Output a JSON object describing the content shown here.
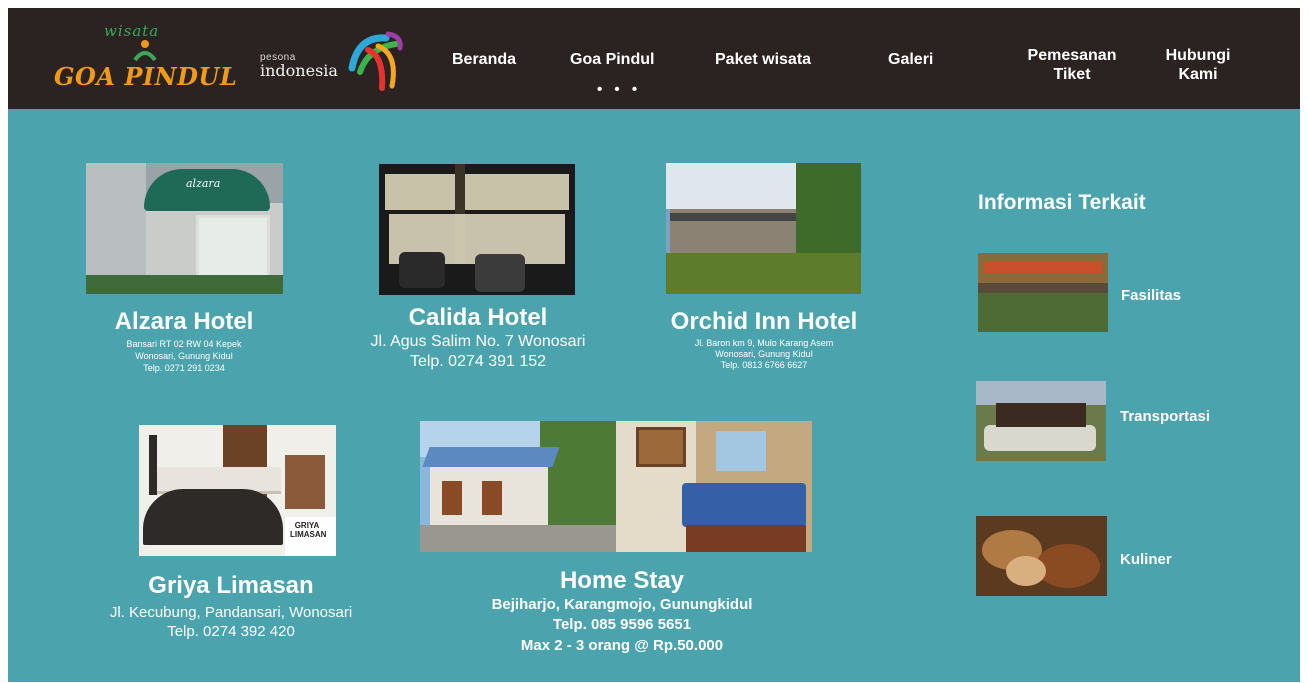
{
  "brand": {
    "script": "wisata",
    "title": "GOA PINDUL",
    "partner_small": "pesona",
    "partner_big": "indonesia"
  },
  "nav": {
    "items": [
      {
        "label": "Beranda"
      },
      {
        "label": "Goa Pindul",
        "dots": "• • •"
      },
      {
        "label": "Paket wisata"
      },
      {
        "label": "Galeri"
      },
      {
        "label": "Pemesanan Tiket"
      },
      {
        "label": "Hubungi Kami"
      }
    ]
  },
  "lodging": [
    {
      "name": "Alzara Hotel",
      "lines": [
        "Bansari RT 02 RW 04 Kepek",
        "Wonosari, Gunung Kidul",
        "Telp. 0271 291 0234"
      ],
      "sign": "alzara"
    },
    {
      "name": "Calida Hotel",
      "lines": [
        "Jl. Agus Salim No. 7 Wonosari",
        "Telp. 0274 391 152"
      ]
    },
    {
      "name": "Orchid Inn Hotel",
      "lines": [
        "Jl. Baron km 9, Mulo Karang Asem",
        "Wonosari, Gunung Kidul",
        "Telp. 0813 6766 6627"
      ]
    },
    {
      "name": "Griya Limasan",
      "lines": [
        "Jl. Kecubung, Pandansari, Wonosari",
        "Telp. 0274 392 420"
      ],
      "sign": "GRIYA LIMASAN"
    },
    {
      "name": "Home Stay",
      "lines": [
        "Bejiharjo, Karangmojo, Gunungkidul",
        "Telp. 085 9596 5651",
        "Max 2 - 3 orang @ Rp.50.000"
      ]
    }
  ],
  "sidebar": {
    "title": "Informasi Terkait",
    "links": [
      {
        "label": "Fasilitas"
      },
      {
        "label": "Transportasi"
      },
      {
        "label": "Kuliner"
      }
    ]
  },
  "colors": {
    "background": "#4aa3ad",
    "navbar": "#2b2222",
    "brand_orange": "#f29a16",
    "brand_green": "#3aa75a"
  }
}
